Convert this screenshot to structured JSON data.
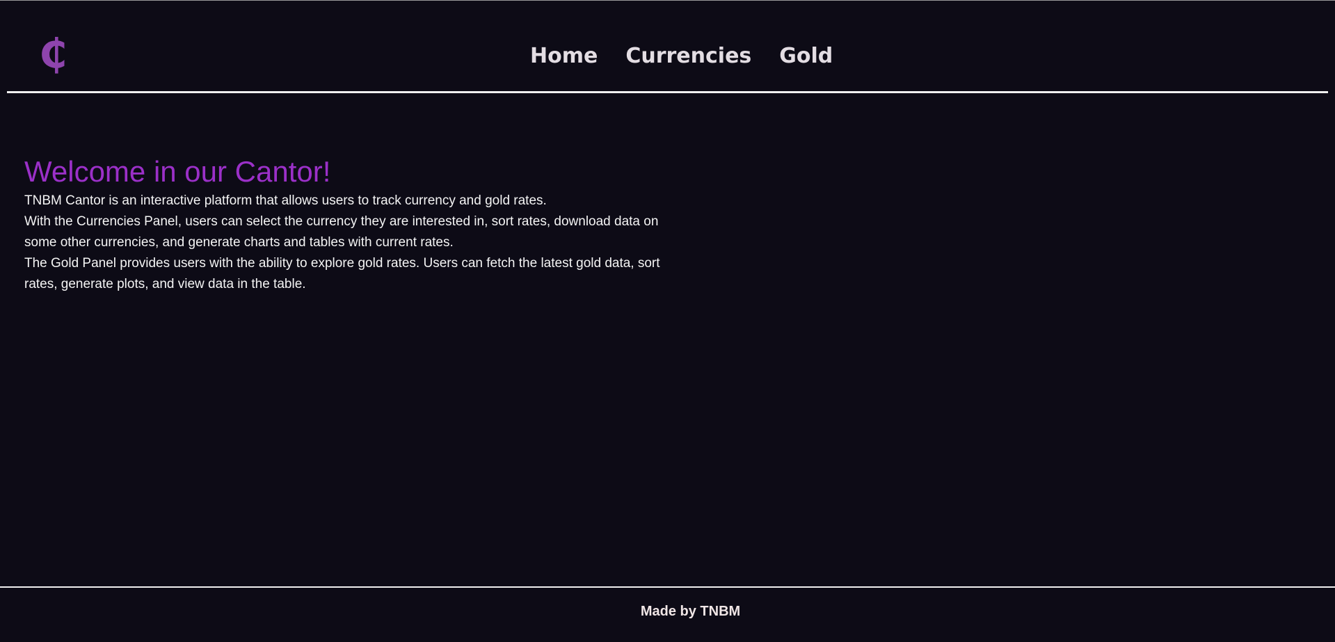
{
  "header": {
    "logo_symbol": "₵",
    "logo_color": "#8e44ad",
    "nav": [
      {
        "label": "Home"
      },
      {
        "label": "Currencies"
      },
      {
        "label": "Gold"
      }
    ]
  },
  "main": {
    "title": "Welcome in our Cantor!",
    "title_color": "#9b30c8",
    "paragraph_lines": [
      "TNBM Cantor is an interactive platform that allows users to track currency and gold rates.",
      "With the Currencies Panel, users can select the currency they are interested in, sort rates, download data on",
      "some other currencies, and generate charts and tables with current rates.",
      "The Gold Panel provides users with the ability to explore gold rates. Users can fetch the latest gold data, sort",
      "rates, generate plots, and view data in the table."
    ]
  },
  "footer": {
    "text": "Made by TNBM"
  },
  "colors": {
    "background": "#0d0b16",
    "text": "#f4f4f4",
    "accent": "#9b30c8"
  }
}
